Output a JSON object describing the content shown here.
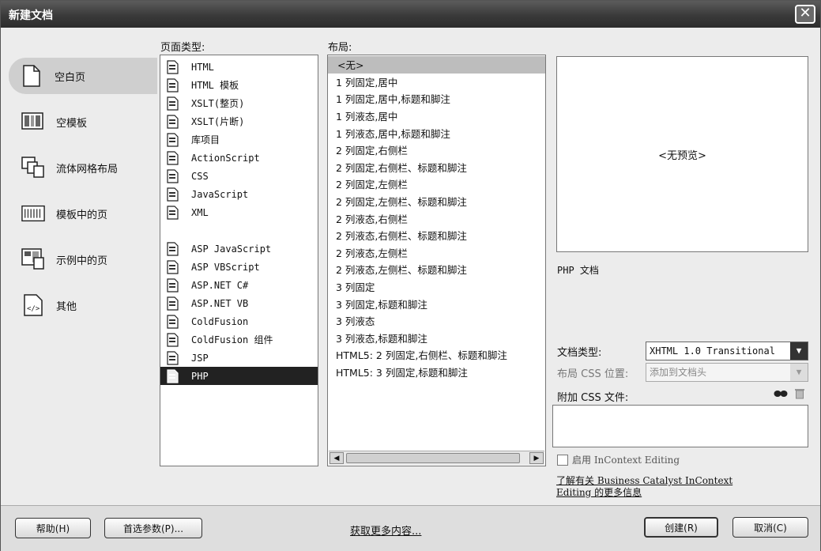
{
  "window": {
    "title": "新建文档"
  },
  "categories": [
    {
      "label": "空白页",
      "icon": "blank-page-icon"
    },
    {
      "label": "空模板",
      "icon": "blank-template-icon"
    },
    {
      "label": "流体网格布局",
      "icon": "fluid-grid-icon"
    },
    {
      "label": "模板中的页",
      "icon": "page-from-template-icon"
    },
    {
      "label": "示例中的页",
      "icon": "page-from-sample-icon"
    },
    {
      "label": "其他",
      "icon": "other-icon"
    }
  ],
  "page_type": {
    "label": "页面类型:",
    "items": [
      "HTML",
      "HTML 模板",
      "XSLT(整页)",
      "XSLT(片断)",
      "库项目",
      "ActionScript",
      "CSS",
      "JavaScript",
      "XML",
      "",
      "ASP JavaScript",
      "ASP VBScript",
      "ASP.NET C#",
      "ASP.NET VB",
      "ColdFusion",
      "ColdFusion 组件",
      "JSP",
      "PHP"
    ],
    "selected": "PHP"
  },
  "layout": {
    "label": "布局:",
    "items": [
      "<无>",
      "1 列固定,居中",
      "1 列固定,居中,标题和脚注",
      "1 列液态,居中",
      "1 列液态,居中,标题和脚注",
      "2 列固定,右侧栏",
      "2 列固定,右侧栏、标题和脚注",
      "2 列固定,左侧栏",
      "2 列固定,左侧栏、标题和脚注",
      "2 列液态,右侧栏",
      "2 列液态,右侧栏、标题和脚注",
      "2 列液态,左侧栏",
      "2 列液态,左侧栏、标题和脚注",
      "3 列固定",
      "3 列固定,标题和脚注",
      "3 列液态",
      "3 列液态,标题和脚注",
      "HTML5: 2 列固定,右侧栏、标题和脚注",
      "HTML5: 3 列固定,标题和脚注"
    ],
    "selected": "<无>"
  },
  "preview": {
    "text": "<无预览>",
    "description": "PHP 文档"
  },
  "doc_type": {
    "label": "文档类型:",
    "value": "XHTML 1.0 Transitional"
  },
  "layout_css": {
    "label": "布局 CSS 位置:",
    "value": "添加到文档头"
  },
  "attach_css": {
    "label": "附加 CSS 文件:"
  },
  "incontext": {
    "label": "启用 InContext Editing"
  },
  "learn_more": {
    "line1": "了解有关 Business Catalyst InContext",
    "line2": "Editing 的更多信息"
  },
  "footer": {
    "help": "帮助(H)",
    "prefs": "首选参数(P)...",
    "get_more": "获取更多内容...",
    "create": "创建(R)",
    "cancel": "取消(C)"
  }
}
